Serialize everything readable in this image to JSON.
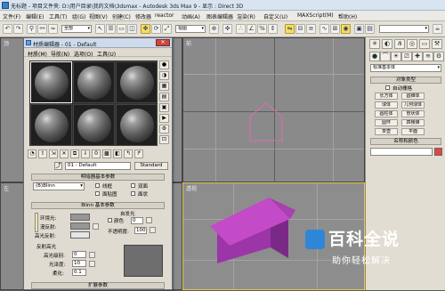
{
  "window": {
    "title": "无标题 - 项目文件夹: D:\\用户目录\\我的文档\\3dsmax - Autodesk 3ds Max 9 - 显示 : Direct 3D"
  },
  "menubar": {
    "items": [
      "文件(F)",
      "编辑(E)",
      "工具(T)",
      "组(G)",
      "视图(V)",
      "创建(C)",
      "修改器",
      "reactor",
      "动画(A)",
      "图表编辑器",
      "渲染(R)",
      "自定义(U)",
      "MAXScript(M)",
      "帮助(H)"
    ]
  },
  "toolbar": {
    "selection_filter": "全部",
    "reference_coord": "视图"
  },
  "material_editor": {
    "title": "材质编辑器 - 01 - Default",
    "menu": [
      "材质(M)",
      "导航(N)",
      "选项(O)",
      "工具(U)"
    ],
    "material_name": "01 - Default",
    "material_type_button": "Standard",
    "rollout_shader_basic": "明暗器基本参数",
    "shader_dropdown": "(B)Blinn",
    "wire_label": "线框",
    "two_sided_label": "双面",
    "face_map_label": "面贴图",
    "faceted_label": "面状",
    "rollout_blinn_basic": "Blinn 基本参数",
    "self_illumination_group": "自发光",
    "ambient_label": "环境光:",
    "diffuse_label": "漫反射:",
    "specular_label": "高光反射:",
    "color_label": "颜色",
    "color_value": "0",
    "opacity_label": "不透明度:",
    "opacity_value": "100",
    "specular_highlights_group": "反射高光",
    "specular_level_label": "高光级别:",
    "specular_level_value": "0",
    "glossiness_label": "光泽度:",
    "glossiness_value": "10",
    "soften_label": "柔化:",
    "soften_value": "0.1",
    "rollout_extended": "扩展参数"
  },
  "viewport": {
    "top_left_label": "顶",
    "top_right_label": "前",
    "bottom_left_label": "左",
    "persp_label": "透视"
  },
  "command_panel": {
    "category_dropdown": "标准基本体",
    "object_type_header": "对象类型",
    "autogrid_label": "自动栅格",
    "buttons": [
      "长方体",
      "圆锥体",
      "球体",
      "几何球体",
      "圆柱体",
      "管状体",
      "圆环",
      "四棱锥",
      "茶壶",
      "平面"
    ],
    "name_color_header": "名称和颜色"
  },
  "colors": {
    "house_wall": "#9b35a8",
    "house_roof": "#c34bc8",
    "selection_outline": "#e26bb0",
    "active_viewport_border": "#e5c84a",
    "name_color_swatch": "#e04646"
  },
  "watermark": {
    "title": "百科全说",
    "subtitle": "助你轻松解决"
  }
}
